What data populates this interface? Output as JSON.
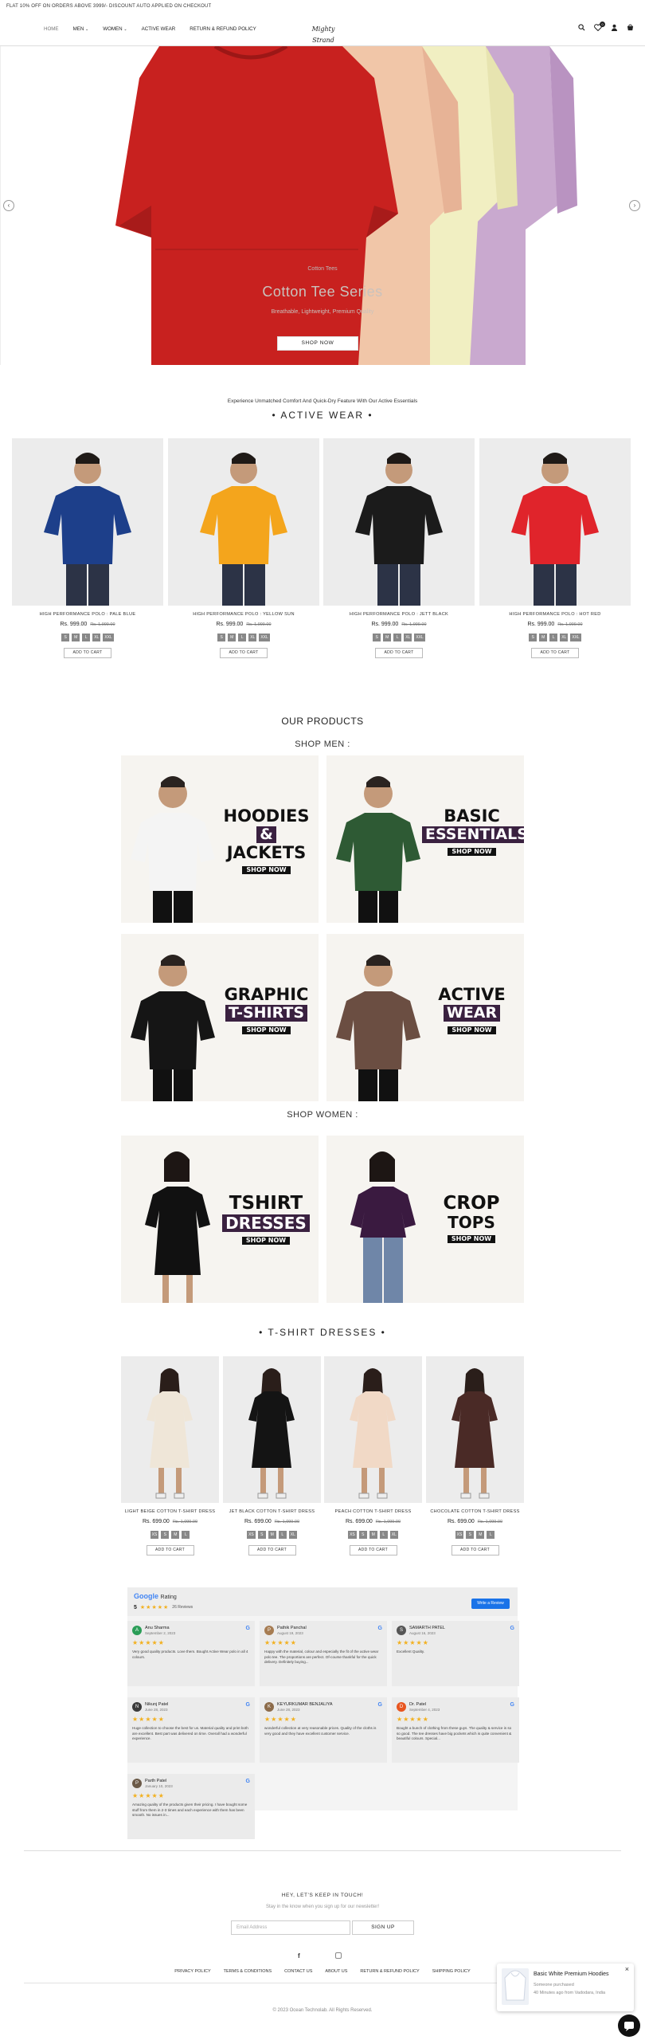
{
  "announcement": "FLAT 10% OFF ON ORDERS ABOVE 3999/- DISCOUNT AUTO APPLIED ON CHECKOUT",
  "nav": {
    "items": [
      "HOME",
      "MEN",
      "WOMEN",
      "ACTIVE WEAR",
      "RETURN & REFUND POLICY"
    ],
    "logo": "Mighty Strand",
    "cart_count": "0"
  },
  "hero": {
    "kicker": "Cotton Tees",
    "title": "Cotton Tee Series",
    "subtitle": "Breathable, Lightweight, Premium Quality",
    "button": "SHOP NOW"
  },
  "active_wear": {
    "tagline": "Experience Unmatched Comfort And Quick-Dry Feature With Our Active Essentials",
    "title": "• ACTIVE WEAR •",
    "products": [
      {
        "name": "HIGH PERFORMANCE POLO : PALE BLUE",
        "price": "Rs. 999.00",
        "compare": "Rs. 1,999.00",
        "sizes": [
          "S",
          "M",
          "L",
          "XL",
          "XXL"
        ],
        "color": "#1d3f8a"
      },
      {
        "name": "HIGH PERFORMANCE POLO : YELLOW SUN",
        "price": "Rs. 999.00",
        "compare": "Rs. 1,999.00",
        "sizes": [
          "S",
          "M",
          "L",
          "XL",
          "XXL"
        ],
        "color": "#f4a51c"
      },
      {
        "name": "HIGH PERFORMANCE POLO : JETT BLACK",
        "price": "Rs. 999.00",
        "compare": "Rs. 1,999.00",
        "sizes": [
          "S",
          "M",
          "L",
          "XL",
          "XXL"
        ],
        "color": "#1b1b1b"
      },
      {
        "name": "HIGH PERFORMANCE POLO : HOT RED",
        "price": "Rs. 999.00",
        "compare": "Rs. 1,999.00",
        "sizes": [
          "S",
          "M",
          "L",
          "XL",
          "XXL"
        ],
        "color": "#e0242b"
      }
    ],
    "add_to_cart": "ADD TO CART"
  },
  "our_products": {
    "title": "OUR PRODUCTS",
    "shop_men": "SHOP MEN :",
    "shop_women": "SHOP WOMEN :",
    "men_banners": [
      {
        "line1": "HOODIES",
        "line2": "&",
        "line3": "JACKETS",
        "cta": "SHOP NOW",
        "shirt": "#f4f4f4"
      },
      {
        "line1": "BASIC",
        "line2": "ESSENTIALS",
        "line3": "",
        "cta": "SHOP NOW",
        "shirt": "#2e5a34"
      },
      {
        "line1": "GRAPHIC",
        "line2": "T-SHIRTS",
        "line3": "",
        "cta": "SHOP NOW",
        "shirt": "#151515"
      },
      {
        "line1": "ACTIVE",
        "line2": "WEAR",
        "line3": "",
        "cta": "SHOP NOW",
        "shirt": "#6b4e42"
      }
    ],
    "women_banners": [
      {
        "line1": "TSHIRT",
        "line2": "DRESSES",
        "cta": "SHOP NOW",
        "shirt": "#111111"
      },
      {
        "line1": "CROP",
        "line2": "TOPS",
        "cta": "SHOP NOW",
        "shirt": "#3a1a40"
      }
    ]
  },
  "dresses": {
    "title": "• T-SHIRT DRESSES •",
    "products": [
      {
        "name": "LIGHT BEIGE COTTON T-SHIRT DRESS",
        "price": "Rs. 699.00",
        "compare": "Rs. 1,099.00",
        "sizes": [
          "XS",
          "S",
          "M",
          "L"
        ],
        "color": "#efe6d8"
      },
      {
        "name": "JET BLACK COTTON T-SHIRT DRESS",
        "price": "Rs. 699.00",
        "compare": "Rs. 1,099.00",
        "sizes": [
          "XS",
          "S",
          "M",
          "L",
          "XL"
        ],
        "color": "#141414"
      },
      {
        "name": "PEACH COTTON T-SHIRT DRESS",
        "price": "Rs. 699.00",
        "compare": "Rs. 1,099.00",
        "sizes": [
          "XS",
          "S",
          "M",
          "L",
          "XL"
        ],
        "color": "#f1d9c6"
      },
      {
        "name": "CHOCOLATE COTTON T-SHIRT DRESS",
        "price": "Rs. 699.00",
        "compare": "Rs. 1,099.00",
        "sizes": [
          "XS",
          "S",
          "M",
          "L"
        ],
        "color": "#4a2a26"
      }
    ],
    "add_to_cart": "ADD TO CART"
  },
  "reviews": {
    "brand": "Google",
    "label": "Rating",
    "score": "5",
    "count": "26 Reviews",
    "write_button": "Write a Review",
    "items": [
      {
        "initial": "A",
        "name": "Anu Sharma",
        "date": "September 2, 2023",
        "text": "Very good quality products. Love them. Bought Active Wear polo in all 4 colours.",
        "avatar": "#2a9d57"
      },
      {
        "initial": "P",
        "name": "Pathik Panchal",
        "date": "August 19, 2023",
        "text": "Happy with the material, colour and especially the fit of the active wear polo tee. The proportions are perfect. Of-course thankful for the quick delivery. Definitely buying...",
        "avatar": "#a67c52"
      },
      {
        "initial": "S",
        "name": "SAMARTH PATEL",
        "date": "August 16, 2023",
        "text": "Excellent Quality.",
        "avatar": "#555555"
      },
      {
        "initial": "N",
        "name": "Nikunj Patel",
        "date": "June 28, 2023",
        "text": "Huge collection to choose the best for us. Material quality and print both are excellent. Best part was delivered on time. Overall had a wonderful experience.",
        "avatar": "#3b3b3b"
      },
      {
        "initial": "K",
        "name": "KEYURKUMAR BENJALIYA",
        "date": "June 28, 2023",
        "text": "wonderful collection at very reasonable prices. Quality of the cloths is very good and they have excellent customer service.",
        "avatar": "#8c6b4a"
      },
      {
        "initial": "D",
        "name": "Dr. Patel",
        "date": "September 4, 2023",
        "text": "Bought a bunch of clothing from these guys. The quality & service is so so good. The tee dresses have big pockets which is quite convenient & beautiful colours. Special...",
        "avatar": "#e8551f"
      },
      {
        "initial": "P",
        "name": "Parth Patel",
        "date": "January 10, 2023",
        "text": "Amazing quality of the products given their pricing. I have bought some stuff from them in 2-3 times and each experience with them has been smooth. No issues in...",
        "avatar": "#6b5a48"
      }
    ]
  },
  "newsletter": {
    "title": "HEY, LET'S KEEP IN TOUCH!",
    "subtitle": "Stay in the know when you sign up for our newsletter!",
    "placeholder": "Email Address",
    "button": "SIGN UP"
  },
  "footer": {
    "links": [
      "PRIVACY POLICY",
      "TERMS & CONDITIONS",
      "CONTACT US",
      "ABOUT US",
      "RETURN & REFUND POLICY",
      "SHIPPING POLICY"
    ],
    "copyright": "© 2023 Ocean Technolab. All Rights Reserved."
  },
  "popup": {
    "title": "Basic White Premium Hoodies",
    "line1": "Someone purchased",
    "line2": "40 Minutes ago from Vadodara, India"
  }
}
